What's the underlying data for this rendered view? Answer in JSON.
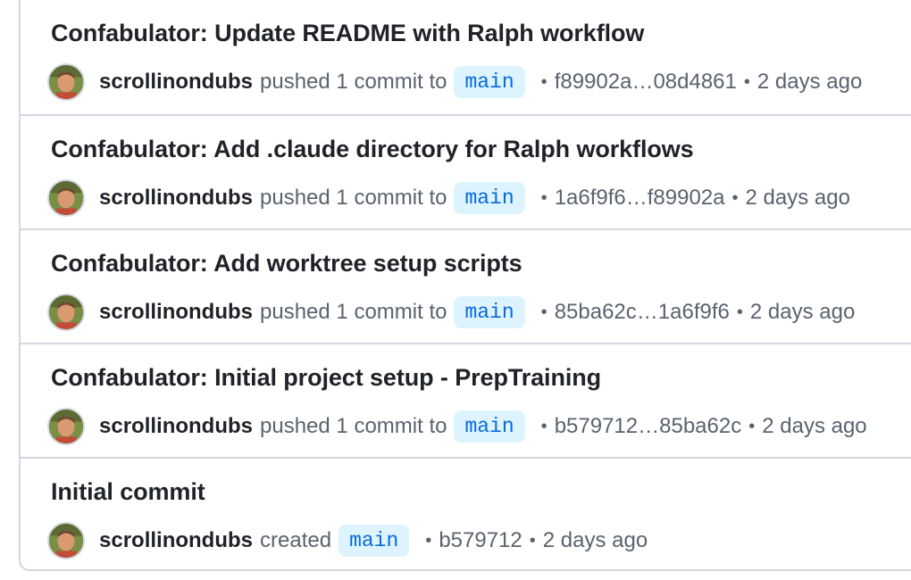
{
  "activity": {
    "items": [
      {
        "title": "Confabulator: Update README with Ralph workflow",
        "user": "scrollinondubs",
        "action": "pushed 1 commit to",
        "branch": "main",
        "commit": "f89902a…08d4861",
        "time": "2 days ago"
      },
      {
        "title": "Confabulator: Add .claude directory for Ralph workflows",
        "user": "scrollinondubs",
        "action": "pushed 1 commit to",
        "branch": "main",
        "commit": "1a6f9f6…f89902a",
        "time": "2 days ago"
      },
      {
        "title": "Confabulator: Add worktree setup scripts",
        "user": "scrollinondubs",
        "action": "pushed 1 commit to",
        "branch": "main",
        "commit": "85ba62c…1a6f9f6",
        "time": "2 days ago"
      },
      {
        "title": "Confabulator: Initial project setup - PrepTraining",
        "user": "scrollinondubs",
        "action": "pushed 1 commit to",
        "branch": "main",
        "commit": "b579712…85ba62c",
        "time": "2 days ago"
      },
      {
        "title": "Initial commit",
        "user": "scrollinondubs",
        "action": "created",
        "branch": "main",
        "commit": "b579712",
        "time": "2 days ago"
      }
    ],
    "separator": "•"
  }
}
